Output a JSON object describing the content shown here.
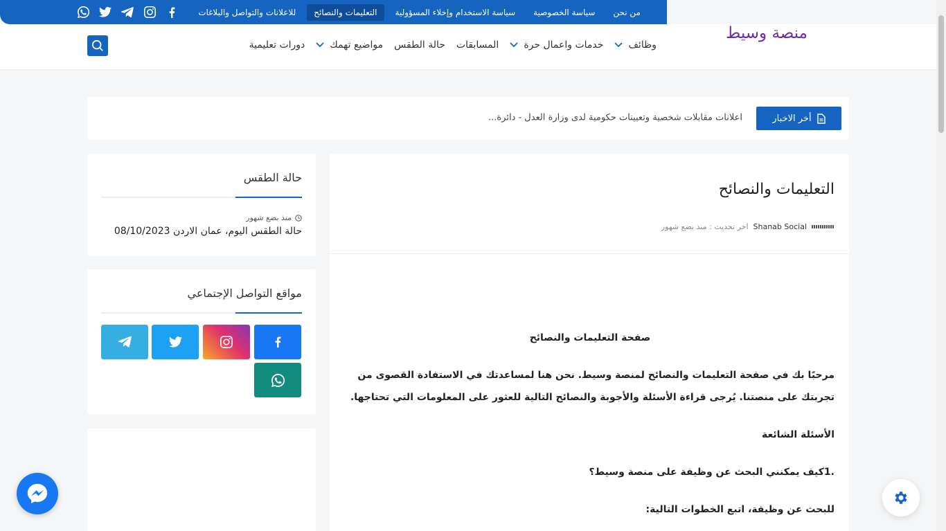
{
  "topbar": {
    "links": [
      {
        "label": "من نحن",
        "active": false
      },
      {
        "label": "سياسة الخصوصية",
        "active": false
      },
      {
        "label": "سياسة الاستخدام وإخلاء المسؤولية",
        "active": false
      },
      {
        "label": "التعليمات والنصائح",
        "active": true
      },
      {
        "label": "للاعلانات والتواصل والبلاغات",
        "active": false
      }
    ],
    "socials": [
      "facebook-icon",
      "instagram-icon",
      "telegram-icon",
      "twitter-icon",
      "whatsapp-icon"
    ]
  },
  "header": {
    "logo": "منصة وسيط",
    "nav": [
      {
        "label": "وظائف",
        "dropdown": true
      },
      {
        "label": "خدمات واعمال حرة",
        "dropdown": true
      },
      {
        "label": "المسابقات",
        "dropdown": false
      },
      {
        "label": "حالة الطقس",
        "dropdown": false
      },
      {
        "label": "مواضيع تهمك",
        "dropdown": true
      },
      {
        "label": "دورات تعليمية",
        "dropdown": false
      }
    ]
  },
  "ticker": {
    "button": "أخر الاخبار",
    "text": "اعلانات مقابلات شخصية وتعيينات حكومية لدى وزارة العدل - دائرة..."
  },
  "article": {
    "title": "التعليمات والنصائح",
    "author": "Shanab Social",
    "updated": "اخر تحديث : منذ بضع شهور",
    "paragraphs": [
      "صفحة التعليمات والنصائح",
      "مرحبًا بك في صفحة التعليمات والنصائح لمنصة وسيط. نحن هنا لمساعدتك في الاستفادة القصوى من تجربتك على منصتنا. يُرجى قراءة الأسئلة والأجوبة والنصائح التالية للعثور على المعلومات التي تحتاجها.",
      "الأسئلة الشائعة",
      ".1كيف يمكنني البحث عن وظيفة على منصة وسيط؟",
      "للبحث عن وظيفة، اتبع الخطوات التالية:"
    ]
  },
  "sidebar": {
    "weather": {
      "title": "حالة الطقس",
      "time": "منذ بضع شهور",
      "post": "حالة الطقس اليوم، عمان الاردن 08/10/2023"
    },
    "social": {
      "title": "مواقع التواصل الإجتماعي",
      "buttons": [
        {
          "icon": "facebook-icon",
          "color": "#1877f2"
        },
        {
          "icon": "instagram-icon",
          "color": "#e1306c"
        },
        {
          "icon": "twitter-icon",
          "color": "#1da1f2"
        },
        {
          "icon": "telegram-icon",
          "color": "#37aee2"
        },
        {
          "icon": "whatsapp-icon",
          "color": "#128c7e"
        }
      ]
    }
  },
  "colors": {
    "primary": "#1565c0",
    "logo": "#6a2fa3"
  }
}
